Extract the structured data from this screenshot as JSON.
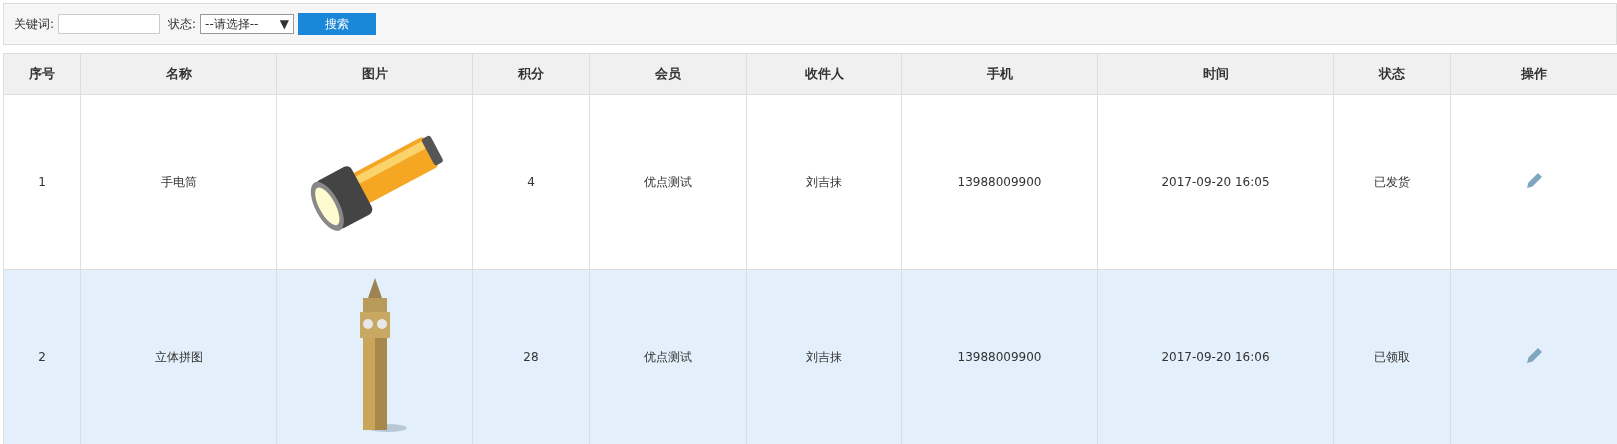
{
  "search_bar": {
    "keyword_label": "关键词:",
    "status_label": "状态:",
    "status_select": "--请选择--",
    "status_caret": "▼",
    "search_button": "搜索"
  },
  "table": {
    "columns": [
      "序号",
      "名称",
      "图片",
      "积分",
      "会员",
      "收件人",
      "手机",
      "时间",
      "状态",
      "操作"
    ],
    "rows": [
      {
        "selected": false,
        "index": "1",
        "name": "手电筒",
        "points": "4",
        "member": "优点测试",
        "recipient": "刘吉抹",
        "phone": "13988009900",
        "time": "2017-09-20 16:05",
        "status": "已发货"
      },
      {
        "selected": true,
        "index": "2",
        "name": "立体拼图",
        "points": "28",
        "member": "优点测试",
        "recipient": "刘吉抹",
        "phone": "13988009900",
        "time": "2017-09-20 16:06",
        "status": "已领取"
      }
    ]
  }
}
